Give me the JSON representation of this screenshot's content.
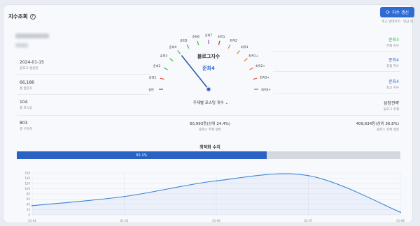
{
  "header": {
    "title": "지수조회",
    "help_icon": "help-icon",
    "refresh_label": "지수 갱신",
    "updated_label": "최근 업데이트:",
    "updated_value": "방금 전"
  },
  "left_stats": [
    {
      "value": "2024-01-15",
      "label": "블로그 생성일"
    },
    {
      "value": "66,186",
      "label": "총 방문자"
    },
    {
      "value": "104",
      "label": "총 포스팅"
    },
    {
      "value": "803",
      "label": "총 구독자"
    }
  ],
  "right_stats": [
    {
      "value": "준최3",
      "label": "주제 지수",
      "color": "#3bb54a"
    },
    {
      "value": "준최4",
      "label": "종합 지수",
      "color": "#2f6bd5"
    },
    {
      "value": "준최4",
      "label": "최고 지수",
      "color": "#2f6bd5"
    },
    {
      "value": "성장전략",
      "label": "블로그 주제",
      "color": "#333333"
    }
  ],
  "gauge": {
    "title": "블로그지수",
    "value": "준최4",
    "labels": [
      "일반",
      "준최1",
      "준최2",
      "준최3",
      "준최4",
      "준최5",
      "준최6",
      "준최7",
      "최적1",
      "최적2",
      "최적3",
      "최적1+",
      "최적2+",
      "최적3+",
      "최적4+"
    ],
    "level": 4
  },
  "dropdown": {
    "label": "주제별 포스팅 개수",
    "icon": "chevron-down-icon"
  },
  "ranks": [
    {
      "value": "60,993등(상위 24.4%)",
      "label": "블렉스 주제 랭킹"
    },
    {
      "value": "409,634등(상위 36.8%)",
      "label": "블렉스 전체 랭킹"
    }
  ],
  "optimization": {
    "label": "최적화 수치",
    "value": 65.1,
    "text": "65.1%"
  },
  "chart_data": {
    "type": "area",
    "x": [
      "01-04",
      "01-05",
      "01-06",
      "01-07",
      "01-08"
    ],
    "values": [
      35,
      70,
      130,
      150,
      10
    ],
    "ylim": [
      0,
      160
    ],
    "yticks": [
      "0",
      "20",
      "40",
      "60",
      "80",
      "100",
      "120",
      "140",
      "160"
    ],
    "grid": true
  }
}
